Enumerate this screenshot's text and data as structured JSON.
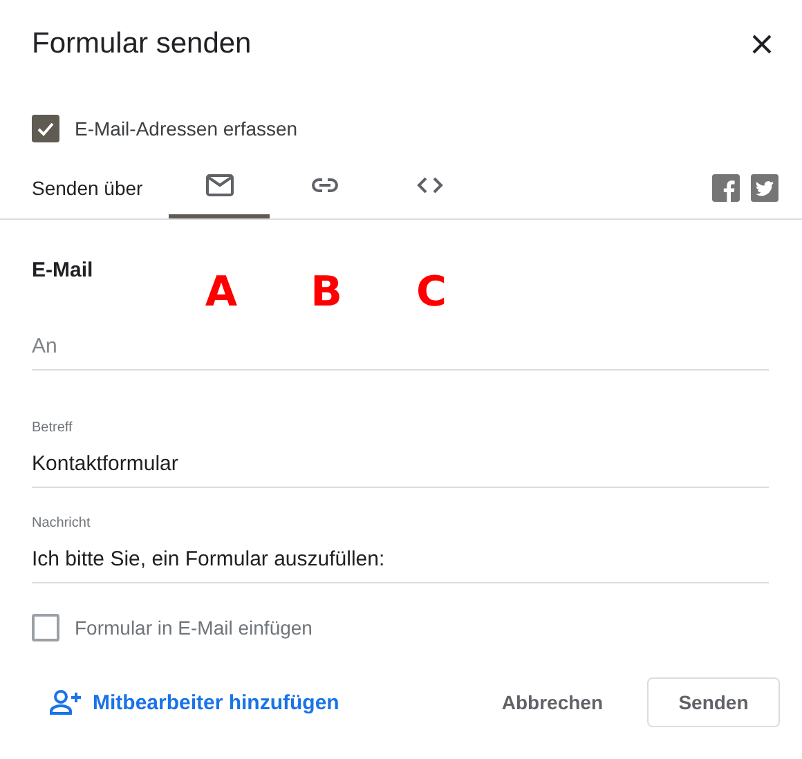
{
  "dialog": {
    "title": "Formular senden"
  },
  "collect_emails": {
    "label": "E-Mail-Adressen erfassen",
    "checked": true
  },
  "send_via": {
    "label": "Senden über",
    "tabs": [
      {
        "kind": "email",
        "selected": true
      },
      {
        "kind": "link",
        "selected": false
      },
      {
        "kind": "embed",
        "selected": false
      }
    ],
    "share": [
      {
        "kind": "facebook"
      },
      {
        "kind": "twitter"
      }
    ]
  },
  "annotations": [
    {
      "label": "A"
    },
    {
      "label": "B"
    },
    {
      "label": "C"
    }
  ],
  "section_title": "E-Mail",
  "fields": [
    {
      "placeholder": "An"
    },
    {
      "label": "Betreff",
      "value": "Kontaktformular"
    },
    {
      "label": "Nachricht",
      "value": "Ich bitte Sie, ein Formular auszufüllen:"
    }
  ],
  "include_form": {
    "label": "Formular in E-Mail einfügen",
    "checked": false
  },
  "footer": {
    "add_collaborators": "Mitbearbeiter hinzufügen",
    "buttons": [
      {
        "label": "Abbrechen",
        "kind": "text"
      },
      {
        "label": "Senden",
        "kind": "outlined"
      }
    ]
  }
}
